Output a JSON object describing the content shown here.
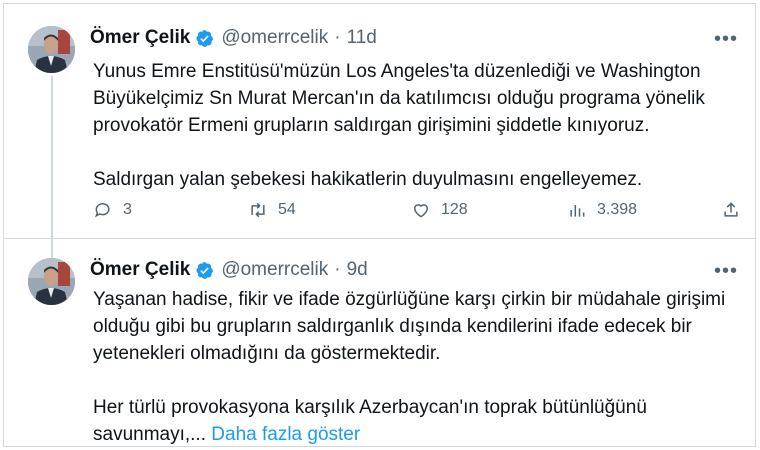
{
  "tweets": [
    {
      "name": "Ömer Çelik",
      "handle": "@omerrcelik",
      "separator": "·",
      "time": "11d",
      "paragraphs": [
        "Yunus Emre Enstitüsü'müzün Los Angeles'ta düzenlediği ve Washington Büyükelçimiz Sn Murat Mercan'ın da katılımcısı olduğu programa yönelik provokatör Ermeni grupların saldırgan girişimini şiddetle kınıyoruz.",
        "Saldırgan yalan şebekesi hakikatlerin duyulmasını engelleyemez."
      ],
      "actions": {
        "replies": "3",
        "retweets": "54",
        "likes": "128",
        "views": "3.398"
      }
    },
    {
      "name": "Ömer Çelik",
      "handle": "@omerrcelik",
      "separator": "·",
      "time": "9d",
      "paragraphs": [
        "Yaşanan hadise, fikir ve ifade özgürlüğüne karşı çirkin bir müdahale girişimi olduğu gibi bu grupların saldırganlık dışında kendilerini ifade edecek bir yetenekleri olmadığını da göstermektedir.",
        "Her türlü provokasyona karşılık Azerbaycan'ın toprak bütünlüğünü savunmayı,..."
      ],
      "show_more": "Daha fazla göster"
    }
  ],
  "more_icon": "more-horizontal-icon",
  "colors": {
    "verified": "#1d9bf0",
    "link": "#1d9bf0",
    "muted": "#536471",
    "border": "#cfd9de"
  }
}
